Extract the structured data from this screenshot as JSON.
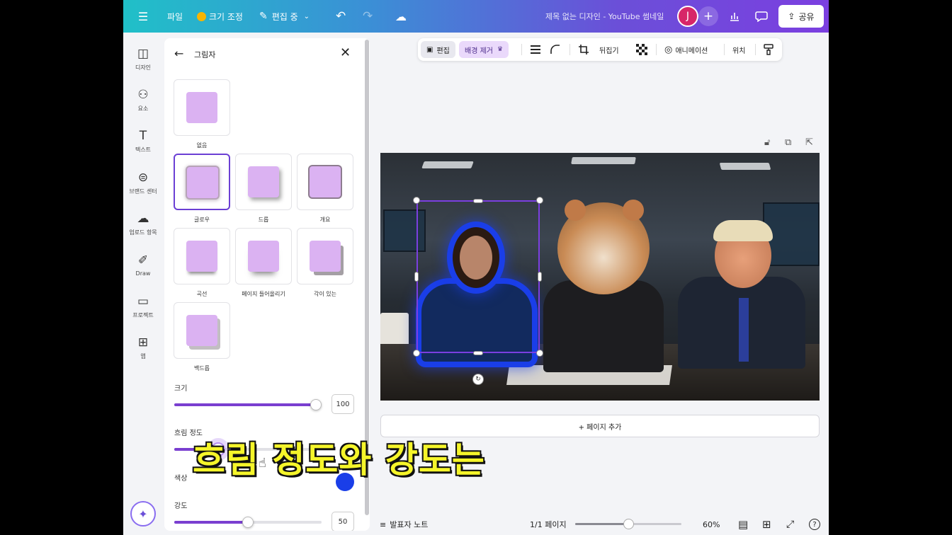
{
  "topbar": {
    "file_label": "파일",
    "resize_label": "크기 조정",
    "edit_mode_label": "편집 중",
    "doc_title": "제목 없는 디자인 - YouTube 썸네일",
    "avatar_initial": "J",
    "share_label": "공유"
  },
  "rail": {
    "items": [
      {
        "label": "디자인",
        "icon": "layout-icon"
      },
      {
        "label": "요소",
        "icon": "shapes-icon"
      },
      {
        "label": "텍스트",
        "icon": "text-icon"
      },
      {
        "label": "브랜드 센터",
        "icon": "brand-icon"
      },
      {
        "label": "업로드 항목",
        "icon": "upload-icon"
      },
      {
        "label": "Draw",
        "icon": "draw-icon"
      },
      {
        "label": "프로젝트",
        "icon": "folder-icon"
      },
      {
        "label": "앱",
        "icon": "apps-icon"
      }
    ]
  },
  "panel": {
    "title": "그림자",
    "effects": [
      {
        "label": "없음",
        "style": "none"
      },
      {
        "label": "글로우",
        "style": "glow",
        "selected": true
      },
      {
        "label": "드롭",
        "style": "drop"
      },
      {
        "label": "개요",
        "style": "outline"
      },
      {
        "label": "곡선",
        "style": "curve"
      },
      {
        "label": "페이지 들어올리기",
        "style": "lift"
      },
      {
        "label": "각이 있는",
        "style": "angle"
      },
      {
        "label": "백드롭",
        "style": "back"
      }
    ],
    "size_label": "크기",
    "size_value": "100",
    "blur_label": "흐림 정도",
    "blur_fraction": 0.31,
    "color_label": "색상",
    "color_value": "#1a3ee8",
    "intensity_label": "강도",
    "intensity_value": "50"
  },
  "context_toolbar": {
    "edit_label": "편집",
    "bg_remove_label": "배경 제거",
    "flip_label": "뒤집기",
    "animate_label": "애니메이션",
    "position_label": "위치"
  },
  "canvas": {
    "add_page_label": "+ 페이지 추가"
  },
  "subtitle": "흐림 정도와 강도는",
  "bottombar": {
    "notes_label": "발표자 노트",
    "page_indicator": "1/1 페이지",
    "zoom_label": "60%",
    "zoom_fraction": 0.5
  }
}
